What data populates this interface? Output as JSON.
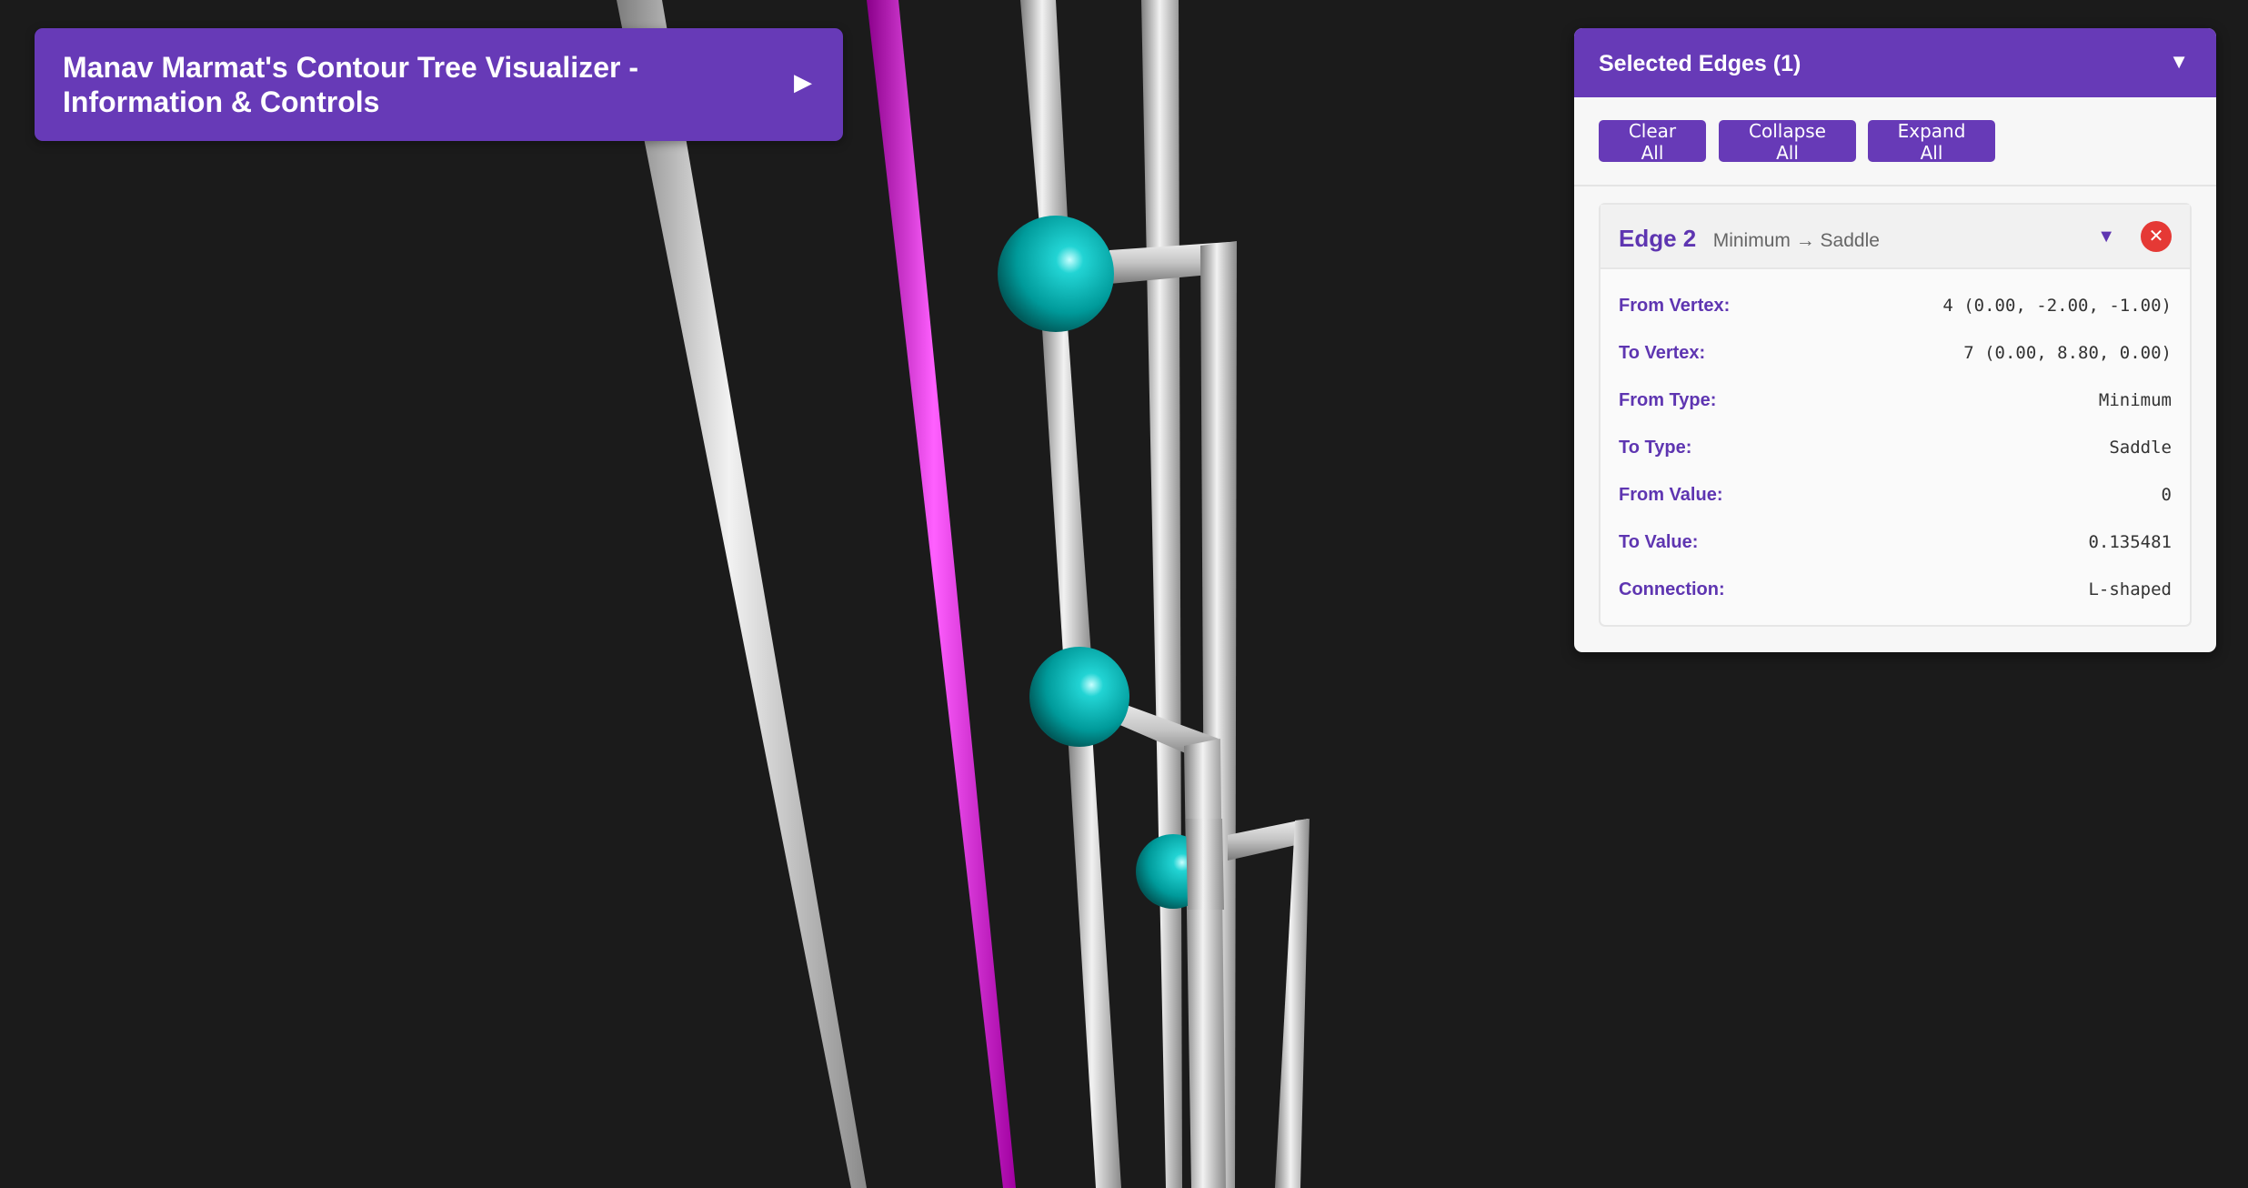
{
  "info_panel": {
    "title": "Manav Marmat's Contour Tree Visualizer - Information & Controls",
    "toggle_icon": "play-right-icon"
  },
  "selected_panel": {
    "title": "Selected Edges (1)",
    "toggle_icon": "chevron-down-icon",
    "buttons": {
      "clear": "Clear All",
      "collapse": "Collapse All",
      "expand": "Expand All"
    },
    "edge": {
      "name": "Edge 2",
      "subtitle": "Minimum → Saddle",
      "rows": [
        {
          "label": "From Vertex:",
          "value": "4 (0.00, -2.00, -1.00)"
        },
        {
          "label": "To Vertex:",
          "value": "7 (0.00, 8.80, 0.00)"
        },
        {
          "label": "From Type:",
          "value": "Minimum"
        },
        {
          "label": "To Type:",
          "value": "Saddle"
        },
        {
          "label": "From Value:",
          "value": "0"
        },
        {
          "label": "To Value:",
          "value": "0.135481"
        },
        {
          "label": "Connection:",
          "value": "L-shaped"
        }
      ]
    }
  },
  "colors": {
    "background": "#1b1b1b",
    "accent": "#673ab7",
    "edge_default": "#b8b8b8",
    "edge_selected": "#d000d0",
    "node": "#00b4b4",
    "close": "#e53935"
  }
}
